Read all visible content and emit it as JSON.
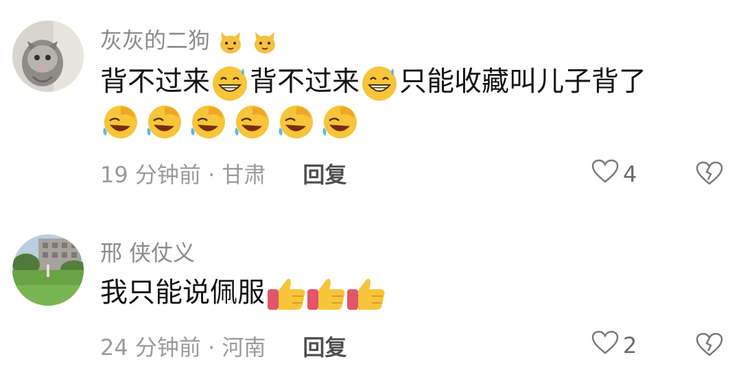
{
  "comments": [
    {
      "username": "灰灰的二狗",
      "username_emojis": [
        "cat-face-icon",
        "cat-face-icon"
      ],
      "text_part1": "背不过来",
      "text_part2": "背不过来",
      "text_part3": "只能收藏叫儿子背了",
      "inline_emojis": [
        "grinning-sweat-icon",
        "grinning-sweat-icon"
      ],
      "emoji_row": [
        "rolling-laughing-icon",
        "rolling-laughing-icon",
        "rolling-laughing-icon",
        "rolling-laughing-icon",
        "rolling-laughing-icon",
        "rolling-laughing-icon"
      ],
      "time": "19 分钟前 · 甘肃",
      "reply_label": "回复",
      "like_count": "4",
      "colors": {
        "name": "#8c8c8c",
        "text": "#141414",
        "meta": "#9a9a9a"
      }
    },
    {
      "username": "邢 侠仗义",
      "text": "我只能说佩服",
      "inline_emojis": [
        "thumbs-up-icon",
        "thumbs-up-icon",
        "thumbs-up-icon"
      ],
      "time": "24 分钟前 · 河南",
      "reply_label": "回复",
      "like_count": "2"
    }
  ]
}
